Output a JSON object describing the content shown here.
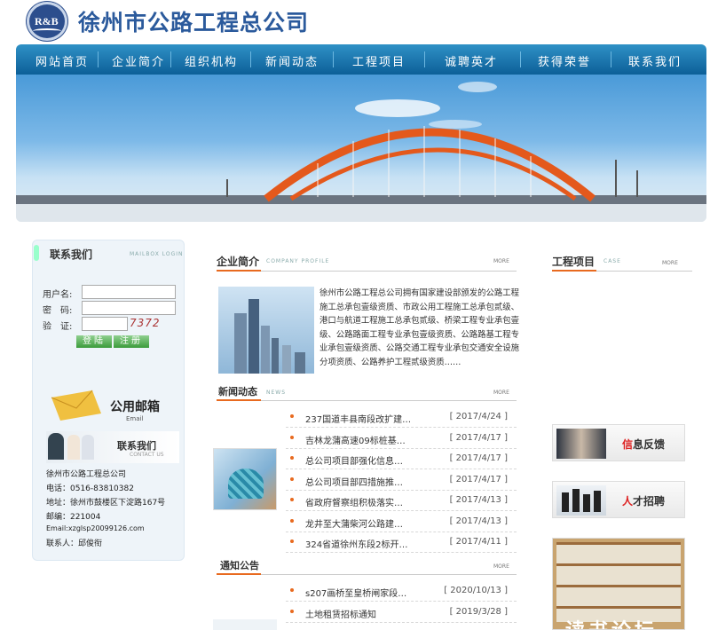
{
  "header": {
    "logo_text": "R&B",
    "company_name": "徐州市公路工程总公司"
  },
  "nav": [
    "网站首页",
    "企业简介",
    "组织机构",
    "新闻动态",
    "工程项目",
    "诚聘英才",
    "获得荣誉",
    "联系我们"
  ],
  "sidebar": {
    "title": "联系我们",
    "sub": "MAILBOX LOGIN",
    "username_label": "用户名:",
    "password_label": "密　码:",
    "captcha_label": "验　证:",
    "captcha_value": "7372",
    "login_button": "登陆",
    "register_button": "注册",
    "mail_title": "公用邮箱",
    "mail_sub": "Email",
    "contact_title": "联系我们",
    "contact_sub": "CONTACT US",
    "contact_lines": [
      "徐州市公路工程总公司",
      "电话：0516-83810382",
      "地址：徐州市鼓楼区下淀路167号",
      "邮编：221004",
      "Email:xzglsp20099126.com",
      "联系人：邱俊衔"
    ]
  },
  "intro": {
    "title": "企业简介",
    "sub": "COMPANY PROFILE",
    "more": "MORE",
    "text": "徐州市公路工程总公司拥有国家建设部颁发的公路工程施工总承包壹级资质、市政公用工程施工总承包贰级、港口与航道工程施工总承包贰级、桥梁工程专业承包壹级、公路路面工程专业承包壹级资质、公路路基工程专业承包壹级资质、公路交通工程专业承包交通安全设施分项资质、公路养护工程贰级资质……"
  },
  "news": {
    "title": "新闻动态",
    "sub": "NEWS",
    "more": "MORE",
    "items": [
      {
        "title": "237国道丰县南段改扩建…",
        "date": "[ 2017/4/24 ]"
      },
      {
        "title": "吉林龙蒲高速09标桩基…",
        "date": "[ 2017/4/17 ]"
      },
      {
        "title": "总公司项目部强化信息…",
        "date": "[ 2017/4/17 ]"
      },
      {
        "title": "总公司项目部四措施推…",
        "date": "[ 2017/4/17 ]"
      },
      {
        "title": "省政府督察组积极落实…",
        "date": "[ 2017/4/13 ]"
      },
      {
        "title": "龙井至大蒲柴河公路建…",
        "date": "[ 2017/4/13 ]"
      },
      {
        "title": "324省道徐州东段2标开…",
        "date": "[ 2017/4/11 ]"
      }
    ]
  },
  "notice": {
    "title": "通知公告",
    "more": "MORE",
    "items": [
      {
        "title": "s207画桥至皇桥闸家段…",
        "date": "[ 2020/10/13 ]"
      },
      {
        "title": "土地租赁招标通知",
        "date": "[ 2019/3/28 ]"
      }
    ]
  },
  "projects": {
    "title": "工程项目",
    "sub": "CASE",
    "more": "MORE"
  },
  "right": {
    "feedback": [
      "信",
      "息反馈"
    ],
    "recruit": [
      "人",
      "才招聘"
    ],
    "reading": "读书论坛"
  }
}
